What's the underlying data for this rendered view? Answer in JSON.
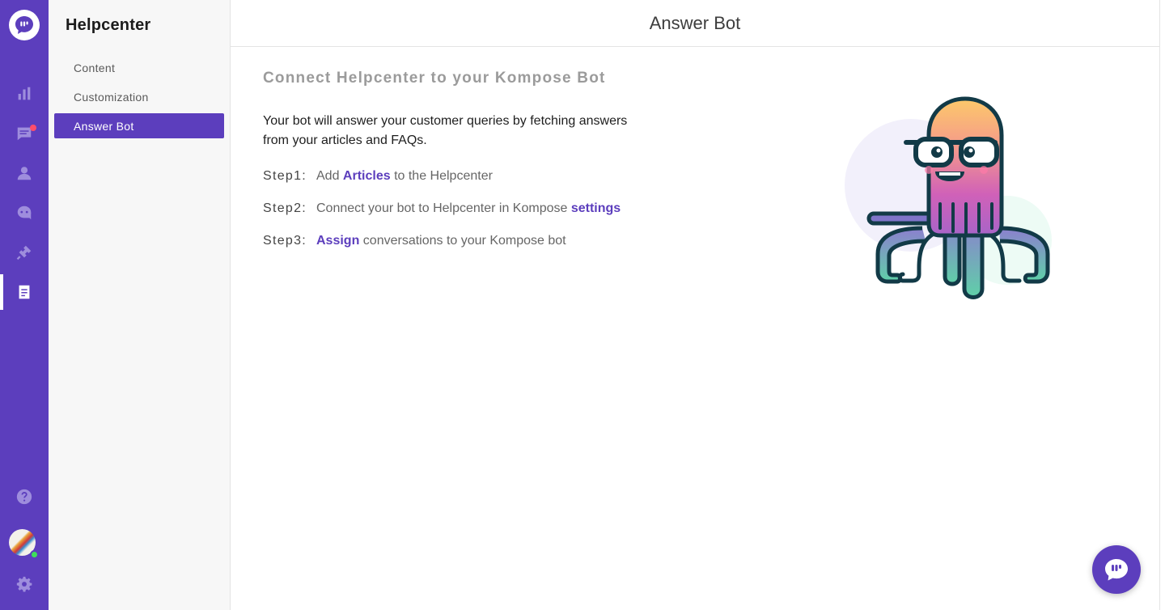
{
  "sidebar": {
    "title": "Helpcenter",
    "items": [
      {
        "label": "Content"
      },
      {
        "label": "Customization"
      },
      {
        "label": "Answer Bot"
      }
    ]
  },
  "header": {
    "title": "Answer Bot"
  },
  "main": {
    "heading": "Connect Helpcenter to your Kompose Bot",
    "description": "Your bot will answer your customer queries by fetching answers from your articles and FAQs.",
    "steps": [
      {
        "label": "Step1:",
        "before": "Add ",
        "link": "Articles",
        "after": " to the Helpcenter"
      },
      {
        "label": "Step2:",
        "before": "Connect your bot to Helpcenter in Kompose ",
        "link": "settings",
        "after": ""
      },
      {
        "label": "Step3:",
        "before": "",
        "link": "Assign",
        "after": " conversations to your Kompose bot"
      }
    ]
  },
  "rail": {
    "icons": [
      "app-logo-icon",
      "reports-icon",
      "conversations-icon",
      "users-icon",
      "bot-icon",
      "integrations-icon",
      "helpcenter-icon",
      "help-icon",
      "settings-icon"
    ],
    "active": "helpcenter-icon"
  },
  "colors": {
    "brand": "#5c3ebd",
    "notification": "#ff4d6a",
    "online": "#3ee05a"
  }
}
